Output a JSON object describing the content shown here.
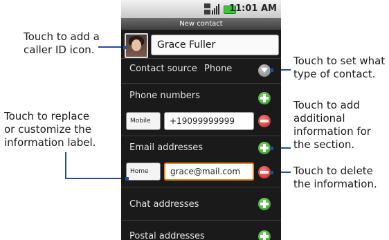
{
  "status_bar": {
    "time": "11:01 AM",
    "network_icon": "network-icon",
    "battery_icon": "battery-icon"
  },
  "header": {
    "title": "New contact"
  },
  "contact": {
    "name": "Grace Fuller",
    "photo_icon": "contact-photo-icon"
  },
  "contact_source": {
    "label": "Contact source",
    "value": "Phone",
    "icon": "dropdown-icon"
  },
  "sections": {
    "phone": {
      "title": "Phone numbers",
      "label_button": "Mobile",
      "value": "+19099999999"
    },
    "email": {
      "title": "Email addresses",
      "label_button": "Home",
      "value": "grace@mail.com"
    },
    "chat": {
      "title": "Chat addresses"
    },
    "postal": {
      "title": "Postal addresses"
    }
  },
  "callouts": {
    "caller_id": [
      "Touch to add a",
      "caller ID icon."
    ],
    "label": [
      "Touch to replace",
      "or customize the",
      "information label."
    ],
    "type": [
      "Touch to set what",
      "type of contact."
    ],
    "add": [
      "Touch to add",
      "additional",
      "information for",
      "the section."
    ],
    "delete": [
      "Touch to delete",
      "the information."
    ]
  },
  "colors": {
    "callout_line": "#1f4e9c",
    "focus": "#f08a1c",
    "add": "#2f8f27",
    "remove": "#c41e1e"
  }
}
